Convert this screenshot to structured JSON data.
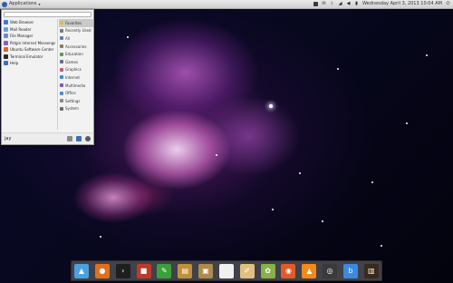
{
  "top_panel": {
    "applications_label": "Applications",
    "clock": "Wednesday April 3, 2013 10:04 AM"
  },
  "menu": {
    "search_placeholder": "",
    "favorites": [
      {
        "label": "Web Browser",
        "color": "#3a7bd5"
      },
      {
        "label": "Mail Reader",
        "color": "#6aa0d8"
      },
      {
        "label": "File Manager",
        "color": "#6a8fc0"
      },
      {
        "label": "Pidgin Internet Messenger",
        "color": "#8a5fb0"
      },
      {
        "label": "Ubuntu Software Center",
        "color": "#d46a2a"
      },
      {
        "label": "Terminal Emulator",
        "color": "#2b2b2b"
      },
      {
        "label": "Help",
        "color": "#3a6fc0"
      }
    ],
    "categories": [
      {
        "label": "Favorites",
        "color": "#e0b84a"
      },
      {
        "label": "Recently Used",
        "color": "#7a7a7a"
      },
      {
        "label": "All",
        "color": "#5a7fb5"
      },
      {
        "label": "Accessories",
        "color": "#8a7a5a"
      },
      {
        "label": "Education",
        "color": "#5a9a5a"
      },
      {
        "label": "Games",
        "color": "#6a6a9a"
      },
      {
        "label": "Graphics",
        "color": "#c05a7a"
      },
      {
        "label": "Internet",
        "color": "#3a8ad0"
      },
      {
        "label": "Multimedia",
        "color": "#7a5ab0"
      },
      {
        "label": "Office",
        "color": "#5a8ac0"
      },
      {
        "label": "Settings",
        "color": "#8a8a8a"
      },
      {
        "label": "System",
        "color": "#6a6a6a"
      }
    ],
    "username": "jay"
  },
  "dock": [
    {
      "name": "home-folder-icon",
      "color": "#4aa0e0",
      "glyph": "▲"
    },
    {
      "name": "firefox-icon",
      "color": "#e0701a",
      "glyph": "●"
    },
    {
      "name": "terminal-icon",
      "color": "#1e1e1e",
      "glyph": "›"
    },
    {
      "name": "bookmarks-icon",
      "color": "#c03a2a",
      "glyph": "■"
    },
    {
      "name": "settings-tool-icon",
      "color": "#3aa03a",
      "glyph": "✎"
    },
    {
      "name": "archive-icon",
      "color": "#c0903a",
      "glyph": "▤"
    },
    {
      "name": "package-icon",
      "color": "#b08a4a",
      "glyph": "▣"
    },
    {
      "name": "text-document-icon",
      "color": "#f0f0f0",
      "glyph": ""
    },
    {
      "name": "text-editor-icon",
      "color": "#e0c080",
      "glyph": "✐"
    },
    {
      "name": "image-viewer-icon",
      "color": "#8ab04a",
      "glyph": "✿"
    },
    {
      "name": "media-player-icon",
      "color": "#e05a2a",
      "glyph": "◉"
    },
    {
      "name": "vlc-icon",
      "color": "#f08a1a",
      "glyph": "▲"
    },
    {
      "name": "disc-icon",
      "color": "#3a3a3a",
      "glyph": "◎"
    },
    {
      "name": "bittorrent-icon",
      "color": "#3a8ae0",
      "glyph": "b"
    },
    {
      "name": "system-monitor-icon",
      "color": "#3a2a1a",
      "glyph": "▥"
    }
  ]
}
